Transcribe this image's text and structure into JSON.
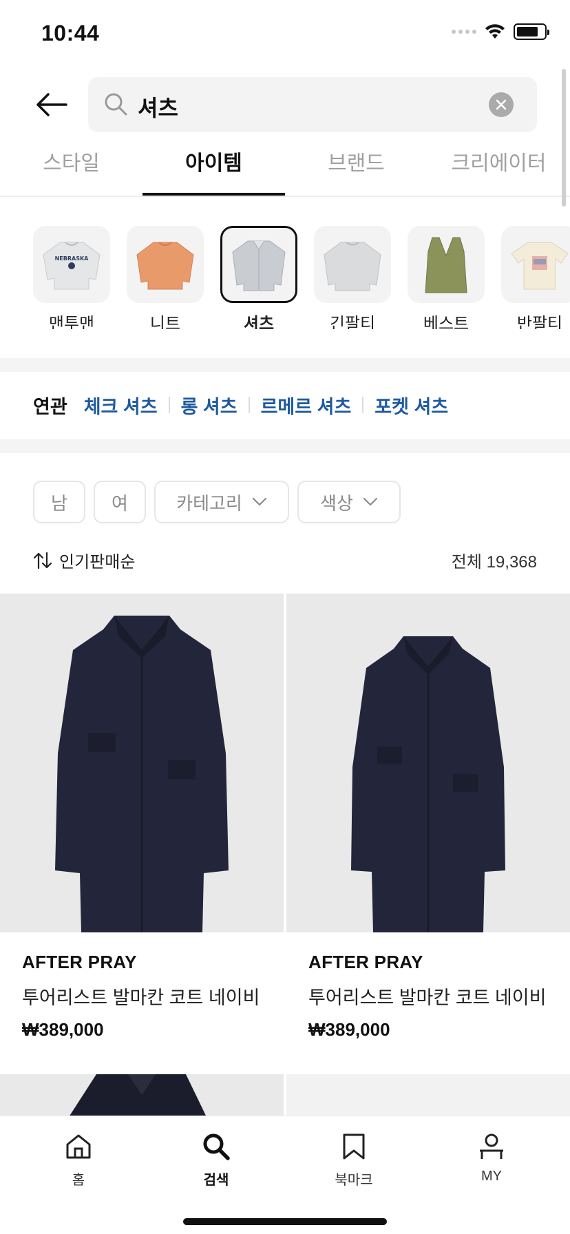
{
  "status_bar": {
    "time": "10:44"
  },
  "search": {
    "query": "셔츠"
  },
  "tabs": [
    {
      "label": "스타일"
    },
    {
      "label": "아이템"
    },
    {
      "label": "브랜드"
    },
    {
      "label": "크리에이터"
    }
  ],
  "active_tab": "아이템",
  "categories": [
    {
      "label": "맨투맨",
      "icon": "sweatshirt-thumb"
    },
    {
      "label": "니트",
      "icon": "knit-thumb"
    },
    {
      "label": "셔츠",
      "icon": "shirt-thumb"
    },
    {
      "label": "긴팔티",
      "icon": "longsleeve-thumb"
    },
    {
      "label": "베스트",
      "icon": "vest-thumb"
    },
    {
      "label": "반팔티",
      "icon": "tshirt-thumb"
    }
  ],
  "related": {
    "title": "연관",
    "items": [
      "체크 셔츠",
      "롱 셔츠",
      "르메르 셔츠",
      "포켓 셔츠"
    ]
  },
  "filters": {
    "male": "남",
    "female": "여",
    "category": "카테고리",
    "color": "색상"
  },
  "sort": {
    "label": "인기판매순"
  },
  "total": "전체 19,368",
  "products": [
    {
      "brand": "AFTER PRAY",
      "name": "투어리스트 발마칸 코트 네이비",
      "price": "₩389,000"
    },
    {
      "brand": "AFTER PRAY",
      "name": "투어리스트 발마칸 코트 네이비",
      "price": "₩389,000"
    }
  ],
  "bottom_nav": {
    "home": "홈",
    "search": "검색",
    "bookmark": "북마크",
    "my": "MY"
  },
  "colors": {
    "accent_link": "#1e5aa0",
    "coat_navy": "#23253a"
  }
}
